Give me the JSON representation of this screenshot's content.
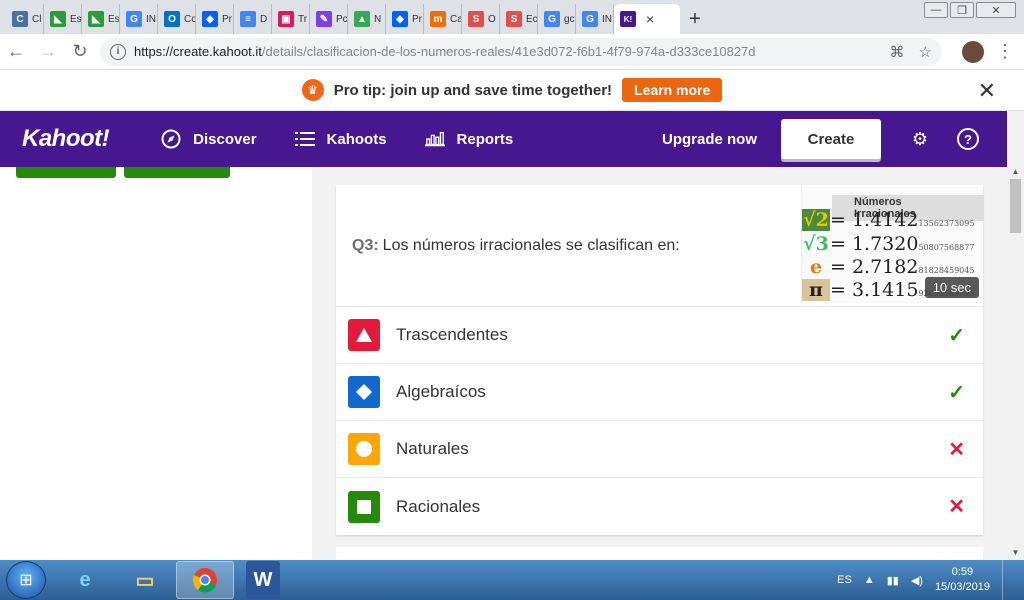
{
  "browser": {
    "tabs": [
      {
        "label": "Cl",
        "icon": "c-icon",
        "color": "#4a6fa5",
        "glyph": "C"
      },
      {
        "label": "Es",
        "icon": "wiki-icon",
        "color": "#2a9d3a",
        "glyph": "◣"
      },
      {
        "label": "Es",
        "icon": "wiki-icon",
        "color": "#2a9d3a",
        "glyph": "◣"
      },
      {
        "label": "IN",
        "icon": "google-icon",
        "color": "#4285f4",
        "glyph": "G"
      },
      {
        "label": "Cc",
        "icon": "outlook-icon",
        "color": "#0072c6",
        "glyph": "O"
      },
      {
        "label": "Pr",
        "icon": "dropbox-icon",
        "color": "#0061ff",
        "glyph": "◆"
      },
      {
        "label": "D",
        "icon": "docs-icon",
        "color": "#4285f4",
        "glyph": "≡"
      },
      {
        "label": "Tr",
        "icon": "contacts-icon",
        "color": "#d81b60",
        "glyph": "▣"
      },
      {
        "label": "Pc",
        "icon": "pencil-icon",
        "color": "#7b3fe4",
        "glyph": "✎"
      },
      {
        "label": "N",
        "icon": "drive-icon",
        "color": "#34a853",
        "glyph": "▲"
      },
      {
        "label": "Pr",
        "icon": "dropbox-icon",
        "color": "#0061ff",
        "glyph": "◆"
      },
      {
        "label": "Ca",
        "icon": "m-icon",
        "color": "#e8710a",
        "glyph": "m"
      },
      {
        "label": "O",
        "icon": "s-icon",
        "color": "#e04e4e",
        "glyph": "S"
      },
      {
        "label": "Ec",
        "icon": "s-icon",
        "color": "#e04e4e",
        "glyph": "S"
      },
      {
        "label": "gc",
        "icon": "google-icon",
        "color": "#4285f4",
        "glyph": "G"
      },
      {
        "label": "IN",
        "icon": "google-icon",
        "color": "#4285f4",
        "glyph": "G"
      }
    ],
    "active_tab": {
      "glyph": "K!",
      "color": "#46178f"
    },
    "url_host": "https://create.kahoot.it",
    "url_path": "/details/clasificacion-de-los-numeros-reales/41e3d072-f6b1-4f79-974a-d333ce10827d"
  },
  "promo": {
    "text": "Pro tip: join up and save time together!",
    "button": "Learn more"
  },
  "nav": {
    "logo": "Kahoot!",
    "discover": "Discover",
    "kahoots": "Kahoots",
    "reports": "Reports",
    "upgrade": "Upgrade now",
    "create": "Create"
  },
  "question": {
    "number": "Q3:",
    "text": "Los números irracionales se clasifican en:",
    "image": {
      "title": "Números Irracionales",
      "rows": [
        {
          "sym": "√2",
          "value": "= 1.4142",
          "tail": "13562373095"
        },
        {
          "sym": "√3",
          "value": "= 1.7320",
          "tail": "50807568877"
        },
        {
          "sym": "e",
          "value": "= 2.7182",
          "tail": "81828459045"
        },
        {
          "sym": "π",
          "value": "= 3.1415",
          "tail": "92653589793"
        }
      ]
    },
    "time": "10 sec",
    "answers": [
      {
        "text": "Trascendentes",
        "color": "#e21b3c",
        "shape": "triangle",
        "correct": true
      },
      {
        "text": "Algebraícos",
        "color": "#1368ce",
        "shape": "diamond",
        "correct": true
      },
      {
        "text": "Naturales",
        "color": "#ffa602",
        "shape": "circle",
        "correct": false
      },
      {
        "text": "Racionales",
        "color": "#26890c",
        "shape": "square",
        "correct": false
      }
    ]
  },
  "taskbar": {
    "lang": "ES",
    "time": "0:59",
    "date": "15/03/2019"
  }
}
